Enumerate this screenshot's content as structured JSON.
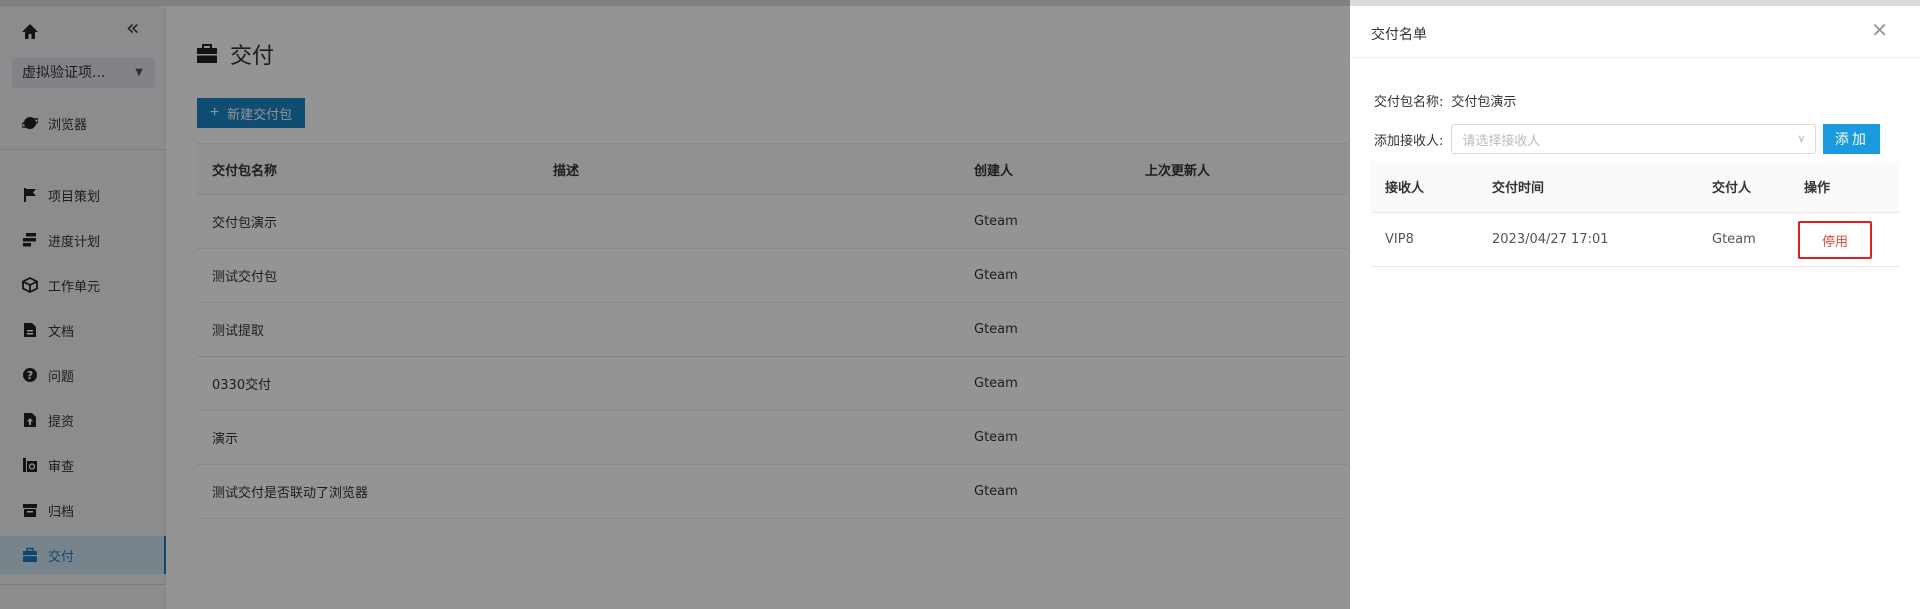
{
  "sidebar": {
    "project": "虚拟验证项...",
    "items": [
      {
        "label": "浏览器",
        "icon": "browser-icon"
      },
      {
        "label": "项目策划",
        "icon": "flag-icon"
      },
      {
        "label": "进度计划",
        "icon": "gantt-icon"
      },
      {
        "label": "工作单元",
        "icon": "cube-icon"
      },
      {
        "label": "文档",
        "icon": "document-icon"
      },
      {
        "label": "问题",
        "icon": "question-icon"
      },
      {
        "label": "提资",
        "icon": "upload-icon"
      },
      {
        "label": "审查",
        "icon": "review-icon"
      },
      {
        "label": "归档",
        "icon": "archive-icon"
      },
      {
        "label": "交付",
        "icon": "briefcase-icon"
      }
    ],
    "active_index": 9
  },
  "main": {
    "title": "交付",
    "new_button": "新建交付包",
    "columns": [
      "交付包名称",
      "描述",
      "创建人",
      "上次更新人"
    ],
    "rows": [
      {
        "name": "交付包演示",
        "desc": "",
        "creator": "Gteam",
        "updater": ""
      },
      {
        "name": "测试交付包",
        "desc": "",
        "creator": "Gteam",
        "updater": ""
      },
      {
        "name": "测试提取",
        "desc": "",
        "creator": "Gteam",
        "updater": ""
      },
      {
        "name": "0330交付",
        "desc": "",
        "creator": "Gteam",
        "updater": ""
      },
      {
        "name": "演示",
        "desc": "",
        "creator": "Gteam",
        "updater": ""
      },
      {
        "name": "测试交付是否联动了浏览器",
        "desc": "",
        "creator": "Gteam",
        "updater": ""
      }
    ]
  },
  "drawer": {
    "title": "交付名单",
    "package_label": "交付包名称:",
    "package_value": "交付包演示",
    "receiver_label": "添加接收人:",
    "receiver_placeholder": "请选择接收人",
    "add_button": "添加",
    "columns": [
      "接收人",
      "交付时间",
      "交付人",
      "操作"
    ],
    "rows": [
      {
        "receiver": "VIP8",
        "time": "2023/04/27 17:01",
        "deliverer": "Gteam",
        "action": "停用"
      }
    ]
  },
  "colors": {
    "primary": "#1a86c7",
    "danger": "#e02020",
    "sidebar_bg": "#f0f2f5"
  }
}
